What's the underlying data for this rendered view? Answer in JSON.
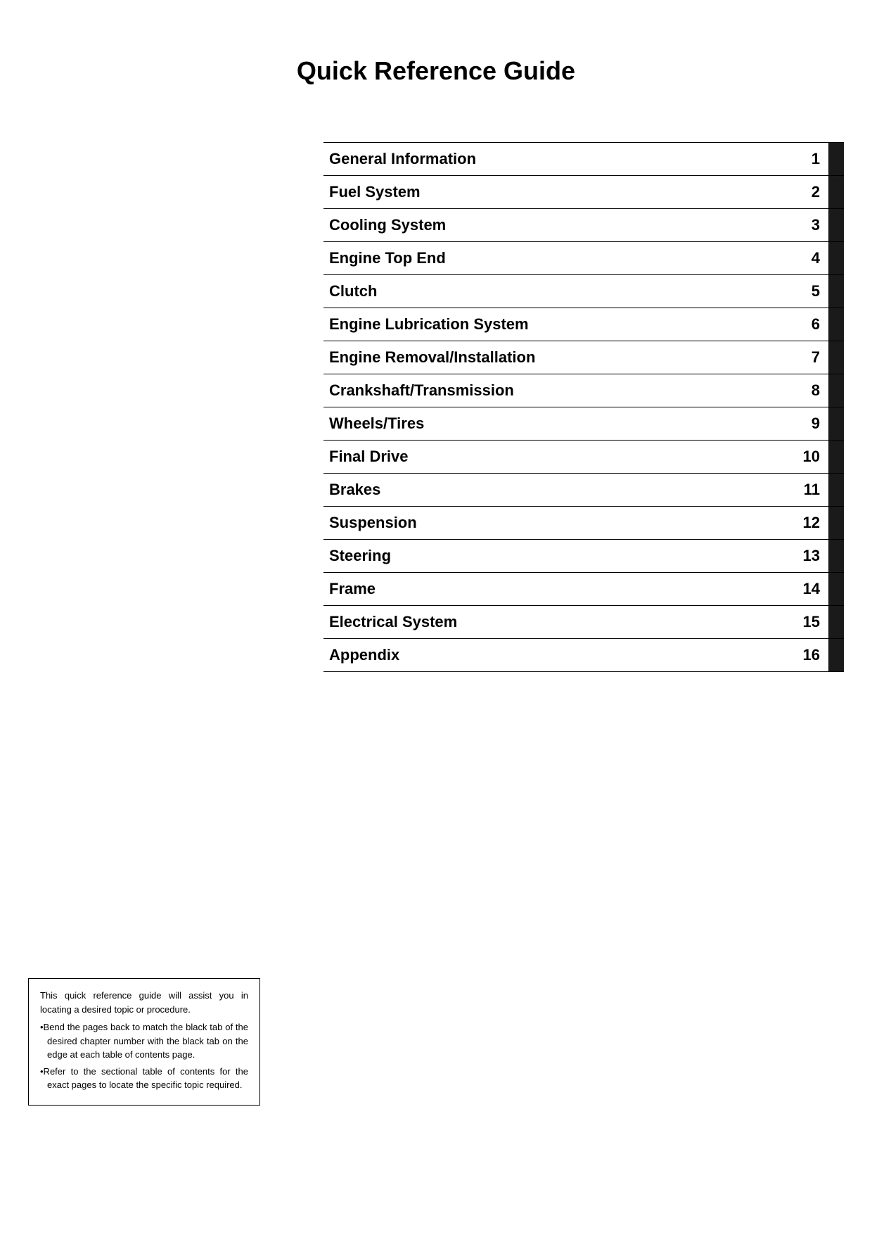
{
  "page": {
    "title": "Quick Reference Guide"
  },
  "toc": {
    "items": [
      {
        "label": "General Information",
        "number": "1"
      },
      {
        "label": "Fuel System",
        "number": "2"
      },
      {
        "label": "Cooling System",
        "number": "3"
      },
      {
        "label": "Engine Top End",
        "number": "4"
      },
      {
        "label": "Clutch",
        "number": "5"
      },
      {
        "label": "Engine Lubrication System",
        "number": "6"
      },
      {
        "label": "Engine Removal/Installation",
        "number": "7"
      },
      {
        "label": "Crankshaft/Transmission",
        "number": "8"
      },
      {
        "label": "Wheels/Tires",
        "number": "9"
      },
      {
        "label": "Final Drive",
        "number": "10"
      },
      {
        "label": "Brakes",
        "number": "11"
      },
      {
        "label": "Suspension",
        "number": "12"
      },
      {
        "label": "Steering",
        "number": "13"
      },
      {
        "label": "Frame",
        "number": "14"
      },
      {
        "label": "Electrical System",
        "number": "15"
      },
      {
        "label": "Appendix",
        "number": "16"
      }
    ]
  },
  "infobox": {
    "line1": "This quick reference guide will assist you in locating a desired topic or procedure.",
    "bullet1": "•Bend the pages back to match the black tab of the desired chapter number with the black tab on the edge at each table of contents page.",
    "bullet2": "•Refer to the sectional table of contents for the exact pages to locate the specific topic required."
  }
}
